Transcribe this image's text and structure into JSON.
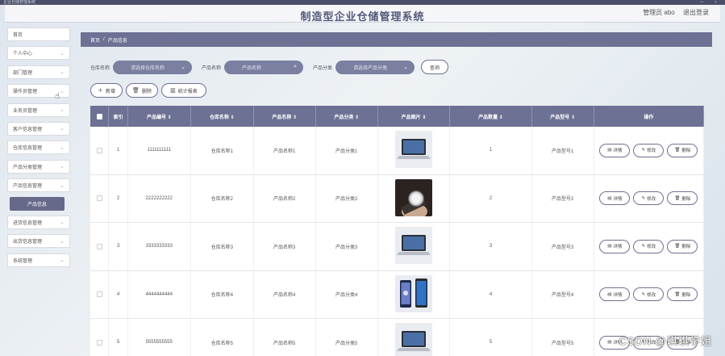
{
  "window": {
    "title": "企业仓储管理系统",
    "controls": "— □"
  },
  "header": {
    "title": "制造型企业仓储管理系统",
    "user": "管理员 abo",
    "logout": "退出登录"
  },
  "sidebar": {
    "items": [
      {
        "label": "首页",
        "chevron": ""
      },
      {
        "label": "个人中心",
        "chevron": "⌄"
      },
      {
        "label": "部门管理",
        "chevron": "⌄"
      },
      {
        "label": "操作员管理",
        "chevron": "⌄"
      },
      {
        "label": "业务员管理",
        "chevron": "⌄"
      },
      {
        "label": "客户信息管理",
        "chevron": "⌄"
      },
      {
        "label": "仓库信息管理",
        "chevron": "⌄"
      },
      {
        "label": "产品分类管理",
        "chevron": "⌄"
      },
      {
        "label": "产品信息管理",
        "chevron": "⌄"
      },
      {
        "label": "进货信息管理",
        "chevron": "⌄"
      },
      {
        "label": "出货信息管理",
        "chevron": "⌄"
      },
      {
        "label": "系统管理",
        "chevron": "⌄"
      }
    ],
    "active_sub": "产品信息"
  },
  "breadcrumb": {
    "home": "首页",
    "sep": "/",
    "current": "产品信息"
  },
  "search": {
    "warehouse_label": "仓库名称",
    "warehouse_placeholder": "请选择仓库名称",
    "name_label": "产品名称",
    "name_placeholder": "产品名称",
    "category_label": "产品分类",
    "category_placeholder": "请选择产品分类",
    "query_button": "查询"
  },
  "actions": {
    "add": "新增",
    "delete": "删除",
    "report": "统计报表"
  },
  "table": {
    "headers": {
      "index": "索引",
      "code": "产品编号 ⇕",
      "warehouse": "仓库名称 ⇕",
      "name": "产品名称 ⇕",
      "category": "产品分类 ⇕",
      "image": "产品图片 ⇕",
      "qty": "产品数量 ⇕",
      "type": "产品型号 ⇕",
      "ops": "操作"
    },
    "ops": {
      "detail": "详情",
      "edit": "修改",
      "delete": "删除"
    },
    "rows": [
      {
        "index": "1",
        "code": "1111111111",
        "warehouse": "仓库名称1",
        "name": "产品名称1",
        "category": "产品分类1",
        "qty": "1",
        "type": "产品型号1",
        "image_icon": "laptop-photo"
      },
      {
        "index": "2",
        "code": "2222222222",
        "warehouse": "仓库名称2",
        "name": "产品名称2",
        "category": "产品分类2",
        "qty": "2",
        "type": "产品型号2",
        "image_icon": "watch-photo"
      },
      {
        "index": "3",
        "code": "3333333333",
        "warehouse": "仓库名称3",
        "name": "产品名称3",
        "category": "产品分类3",
        "qty": "3",
        "type": "产品型号3",
        "image_icon": "laptop-photo"
      },
      {
        "index": "4",
        "code": "4444444444",
        "warehouse": "仓库名称4",
        "name": "产品名称4",
        "category": "产品分类4",
        "qty": "4",
        "type": "产品型号4",
        "image_icon": "phone-photo"
      },
      {
        "index": "5",
        "code": "5555555555",
        "warehouse": "仓库名称5",
        "name": "产品名称5",
        "category": "产品分类5",
        "qty": "5",
        "type": "产品型号5",
        "image_icon": "laptop-photo"
      }
    ]
  },
  "watermark": "CSDN @琪琪学姐",
  "colors": {
    "accent": "#6d7193",
    "pill": "#7b7fa0",
    "active_sub": "#66698a"
  }
}
